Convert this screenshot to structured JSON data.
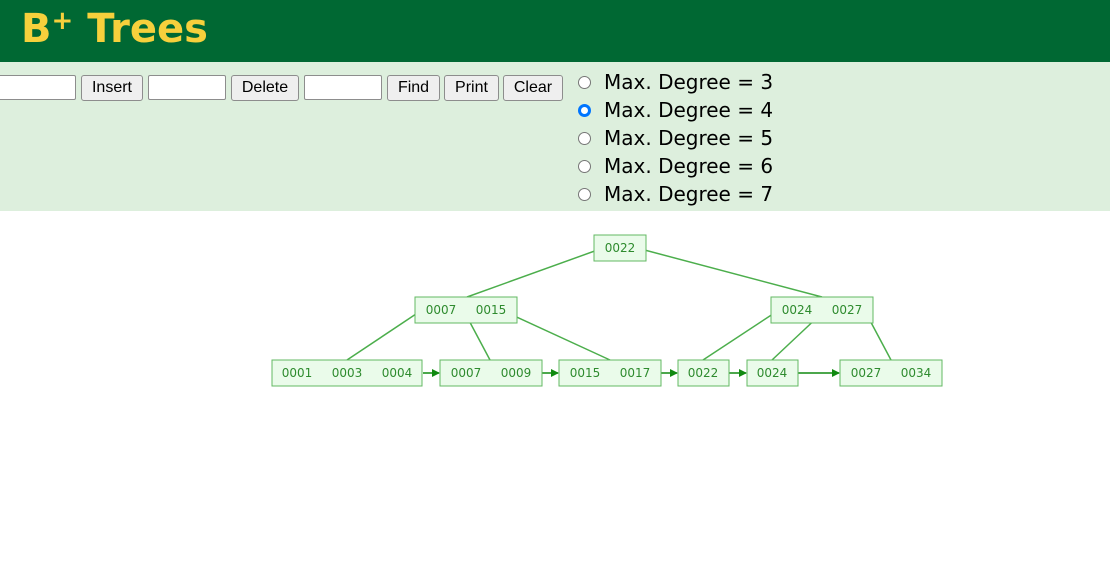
{
  "header": {
    "title_main": "B",
    "title_sup": "+",
    "title_rest": " Trees"
  },
  "toolbar": {
    "insert_input_value": "",
    "insert_label": "Insert",
    "delete_input_value": "",
    "delete_label": "Delete",
    "find_input_value": "",
    "find_label": "Find",
    "print_label": "Print",
    "clear_label": "Clear"
  },
  "degree_options": [
    {
      "label": "Max. Degree = 3",
      "checked": false
    },
    {
      "label": "Max. Degree = 4",
      "checked": true
    },
    {
      "label": "Max. Degree = 5",
      "checked": false
    },
    {
      "label": "Max. Degree = 6",
      "checked": false
    },
    {
      "label": "Max. Degree = 7",
      "checked": false
    }
  ],
  "tree": {
    "root": [
      "0022"
    ],
    "internal": [
      [
        "0007",
        "0015"
      ],
      [
        "0024",
        "0027"
      ]
    ],
    "leaves": [
      [
        "0001",
        "0003",
        "0004"
      ],
      [
        "0007",
        "0009"
      ],
      [
        "0015",
        "0017"
      ],
      [
        "0022"
      ],
      [
        "0024"
      ],
      [
        "0027",
        "0034"
      ]
    ]
  },
  "colors": {
    "header_bg": "#006833",
    "title": "#f6d03c",
    "controls_bg": "#ddefdd",
    "node_fill": "#eafbea",
    "node_border": "#63b863",
    "edge": "#4cae4c",
    "leaf_link": "#118a11"
  }
}
